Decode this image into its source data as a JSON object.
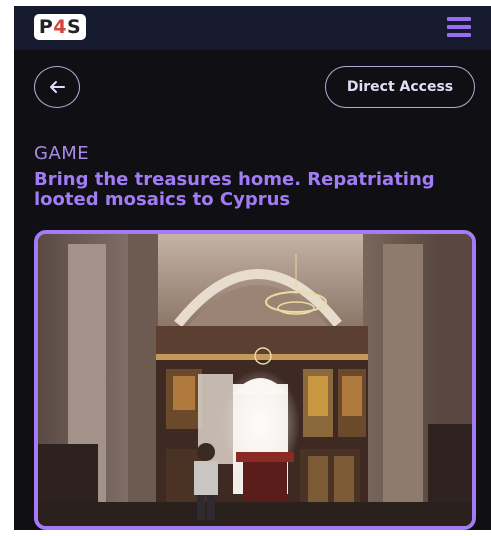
{
  "header": {
    "logo": {
      "text_before": "P",
      "text_accent": "4",
      "text_after": "S"
    },
    "menu_icon": "hamburger-icon",
    "bg_color": "#161a2e",
    "accent_color": "#9a6cf2"
  },
  "nav": {
    "back_icon": "arrow-left-icon",
    "direct_access_label": "Direct Access"
  },
  "content": {
    "category": "GAME",
    "title": "Bring the treasures home. Repatriating looted mosaics to Cyprus",
    "image": {
      "subject": "church interior with iconostasis and a child standing in the nave"
    }
  },
  "colors": {
    "page_bg": "#0f0f14",
    "title": "#a27cf5",
    "image_border": "#a47af6"
  }
}
